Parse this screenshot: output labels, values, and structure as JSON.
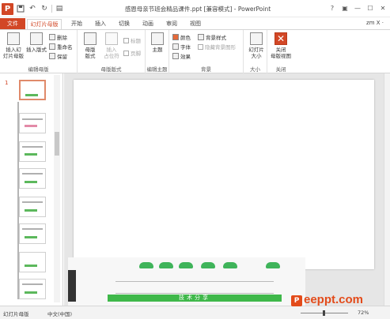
{
  "window": {
    "title": "感恩母亲节班会精品课件.ppt [兼容模式] - PowerPoint",
    "controls": [
      "?",
      "▣",
      "—",
      "☐",
      "✕"
    ]
  },
  "qat": {
    "app_icon": "P",
    "save_icon": "floppy-icon",
    "undo": "↶",
    "redo": "↻",
    "present": "▤"
  },
  "tabs": {
    "file": "文件",
    "active": "幻灯片母版",
    "items": [
      "开始",
      "插入",
      "切换",
      "动画",
      "审阅",
      "视图"
    ],
    "user": "zm X ·"
  },
  "ribbon": {
    "edit_master": {
      "label": "编辑母版",
      "insert_slide_master": "插入幻\n灯片母版",
      "insert_layout": "插入版式",
      "delete": "删除",
      "rename": "重命名",
      "preserve": "保留"
    },
    "master_layout": {
      "label": "母版版式",
      "master_layout_btn": "母版\n版式",
      "insert_placeholder": "插入\n占位符",
      "title_chk": "标题",
      "footer_chk": "页脚"
    },
    "edit_theme": {
      "label": "编辑主题",
      "themes": "主题"
    },
    "background": {
      "label": "背景",
      "colors": "颜色",
      "fonts": "字体",
      "effects": "效果",
      "bg_styles": "背景样式",
      "hide_bg": "隐藏背景图形"
    },
    "size": {
      "label": "大小",
      "slide_size": "幻灯片\n大小"
    },
    "close": {
      "label": "关闭",
      "close_master": "关闭\n母版视图"
    }
  },
  "thumbnails": {
    "first_number": "1"
  },
  "slide_image": {
    "bar_text": "技术分享"
  },
  "status": {
    "view": "幻灯片母版",
    "language": "中文(中国)",
    "zoom": "72%"
  },
  "brand": {
    "logo": "P",
    "text": "eeppt.com"
  }
}
